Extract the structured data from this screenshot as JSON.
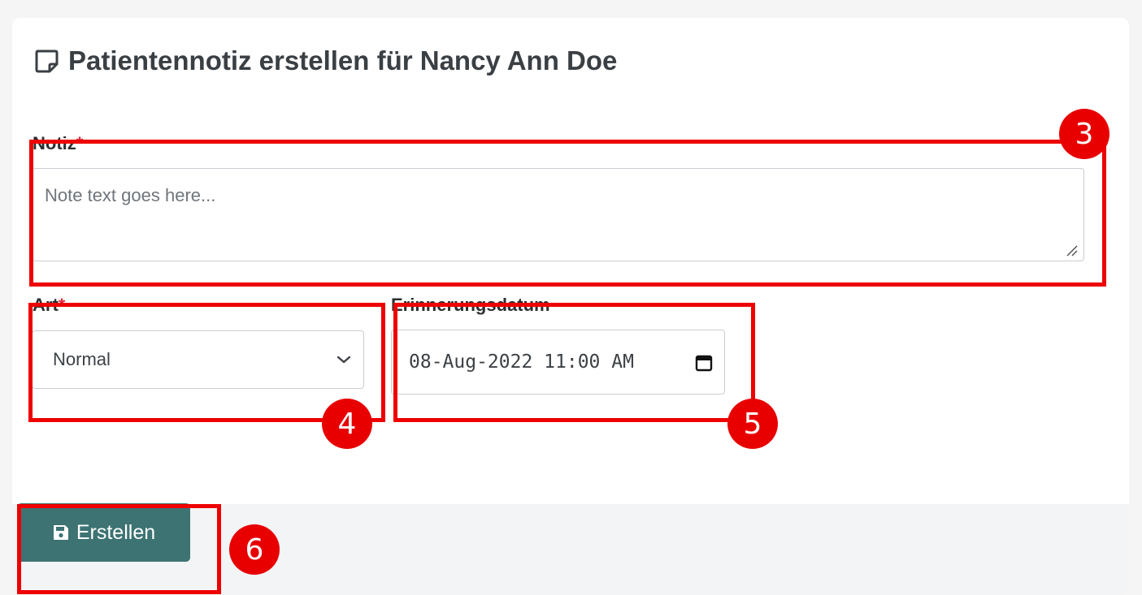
{
  "form": {
    "title": "Patientennotiz erstellen für Nancy Ann Doe",
    "title_icon": "sticky-note-icon",
    "note_label": "Notiz",
    "note_required": "*",
    "note_placeholder": "Note text goes here...",
    "note_value": "",
    "type_label": "Art",
    "type_required": "*",
    "type_selected": "Normal",
    "reminder_label": "Erinnerungsdatum",
    "reminder_value": "08-Aug-2022 11:00 AM",
    "save_label": "Erstellen",
    "save_icon": "floppy-disk-icon"
  },
  "annotations": {
    "note_badge": "3",
    "type_badge": "4",
    "reminder_badge": "5",
    "save_badge": "6"
  },
  "colors": {
    "primary_button": "#3d7373",
    "required_marker": "#e0283a",
    "annotation_red": "#ee0000"
  }
}
